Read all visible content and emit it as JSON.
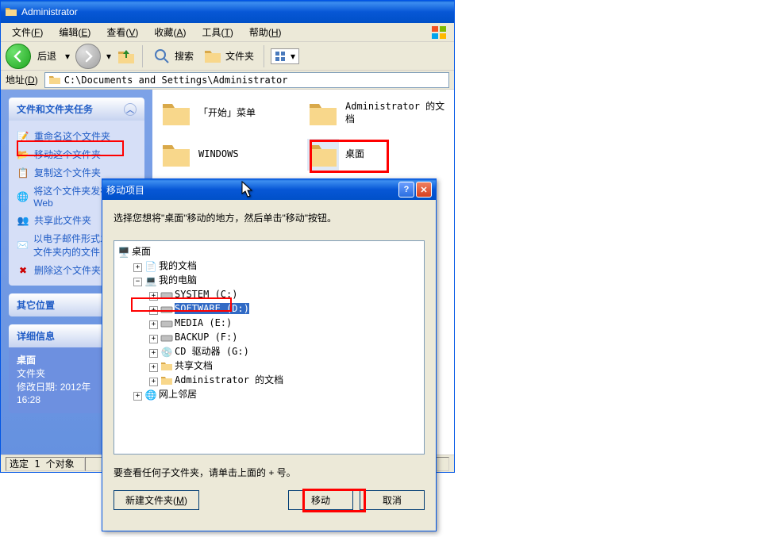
{
  "window": {
    "title": "Administrator"
  },
  "menu": {
    "file": "文件",
    "file_k": "F",
    "edit": "编辑",
    "edit_k": "E",
    "view": "查看",
    "view_k": "V",
    "fav": "收藏",
    "fav_k": "A",
    "tools": "工具",
    "tools_k": "T",
    "help": "帮助",
    "help_k": "H"
  },
  "toolbar": {
    "back": "后退",
    "search": "搜索",
    "folders": "文件夹"
  },
  "address": {
    "label": "地址",
    "label_k": "D",
    "path": "C:\\Documents and Settings\\Administrator"
  },
  "sidebar": {
    "tasks_title": "文件和文件夹任务",
    "tasks": [
      "重命名这个文件夹",
      "移动这个文件夹",
      "复制这个文件夹",
      "将这个文件夹发布到 Web",
      "共享此文件夹",
      "以电子邮件形式发送该文件夹内的文件",
      "删除这个文件夹"
    ],
    "other_title": "其它位置",
    "details_title": "详细信息",
    "details": {
      "name": "桌面",
      "type": "文件夹",
      "modified_label": "修改日期:",
      "modified_value": "2012年",
      "modified_time": "16:28"
    }
  },
  "folders": {
    "start_menu": "「开始」菜单",
    "admin_docs": "Administrator 的文档",
    "windows": "WINDOWS",
    "desktop": "桌面"
  },
  "status": {
    "selection": "选定 1 个对象"
  },
  "dialog": {
    "title": "移动项目",
    "instruction": "选择您想将\"桌面\"移动的地方，然后单击\"移动\"按钮。",
    "hint": "要查看任何子文件夹，请单击上面的 + 号。",
    "btn_newfolder": "新建文件夹",
    "btn_newfolder_k": "M",
    "btn_move": "移动",
    "btn_cancel": "取消"
  },
  "tree": {
    "desktop": "桌面",
    "my_docs": "我的文档",
    "my_computer": "我的电脑",
    "system_c": "SYSTEM (C:)",
    "software_d": "SOFTWARE (D:)",
    "media_e": "MEDIA (E:)",
    "backup_f": "BACKUP (F:)",
    "cd_g": "CD 驱动器 (G:)",
    "shared_docs": "共享文档",
    "admin_docs": "Administrator 的文档",
    "network": "网上邻居"
  }
}
